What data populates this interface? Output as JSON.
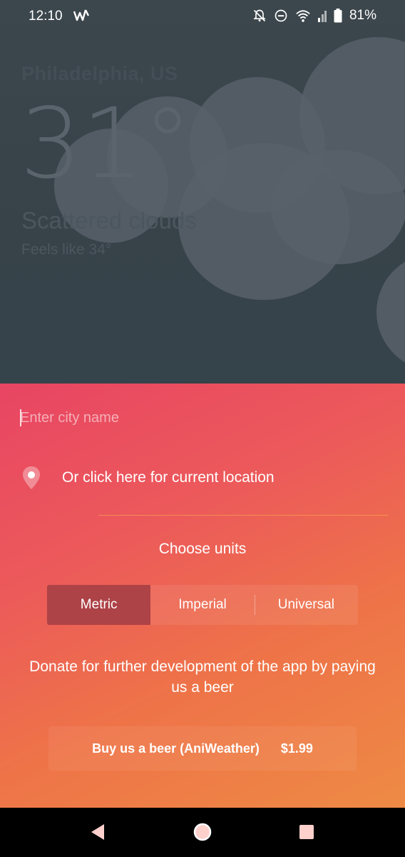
{
  "status_bar": {
    "time": "12:10",
    "battery": "81%",
    "icons": [
      "activity-icon",
      "notifications-off-icon",
      "do-not-disturb-icon",
      "wifi-icon",
      "signal-icon",
      "battery-icon"
    ]
  },
  "weather": {
    "city": "Philadelphia, US",
    "temperature": "31°",
    "condition": "Scattered clouds",
    "feels_like": "Feels like 34°"
  },
  "settings": {
    "city_input": {
      "placeholder": "Enter city name",
      "value": ""
    },
    "location_label": "Or click here for current location",
    "units_title": "Choose units",
    "units": [
      {
        "label": "Metric",
        "selected": true
      },
      {
        "label": "Imperial",
        "selected": false
      },
      {
        "label": "Universal",
        "selected": false
      }
    ],
    "donate_text": "Donate for further development of the app by paying us a beer",
    "beer_button": {
      "label": "Buy us a beer (AniWeather)",
      "price": "$1.99"
    }
  },
  "nav_bar": {
    "icons": [
      "back-icon",
      "home-icon",
      "recents-icon"
    ]
  },
  "colors": {
    "weather_bg": "#3c474d",
    "gradient_start": "#e84563",
    "gradient_end": "#ee8a45",
    "selected_unit": "#ad4247"
  }
}
